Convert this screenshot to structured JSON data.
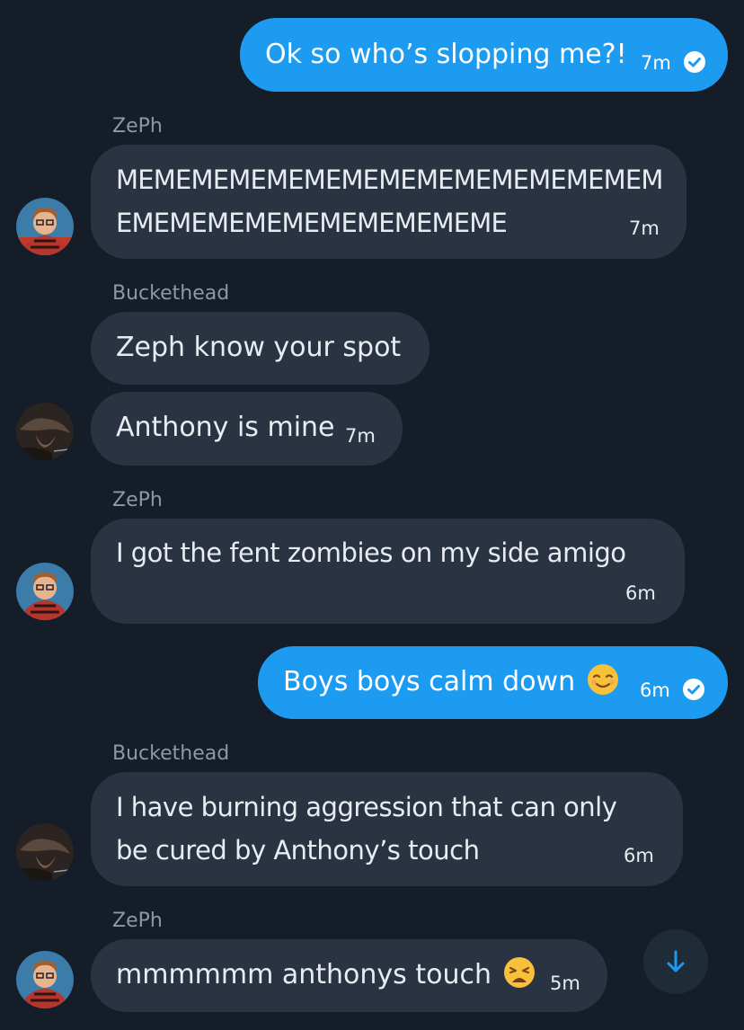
{
  "messages": [
    {
      "text": "Ok so who’s slopping me?!",
      "time": "7m"
    },
    {
      "sender": "ZePh",
      "line1": "MEMEMEMEMEMEMEMEMEMEMEMEMEMEM",
      "line2": "EMEMEMEMEMEMEMEMEMEME",
      "time": "7m"
    },
    {
      "sender": "Buckethead",
      "text": "Zeph know your spot"
    },
    {
      "text": "Anthony is mine",
      "time": "7m"
    },
    {
      "sender": "ZePh",
      "text": "I got the fent zombies on my side amigo",
      "time": "6m"
    },
    {
      "text": "Boys boys calm down",
      "emoji": "relieved-smile-emoji",
      "time": "6m"
    },
    {
      "sender": "Buckethead",
      "line1": "I have burning aggression that can only",
      "line2": "be cured by Anthony’s touch",
      "time": "6m"
    },
    {
      "sender": "ZePh",
      "text": "mmmmmm anthonys touch",
      "emoji": "weary-face-emoji",
      "time": "5m"
    }
  ],
  "colors": {
    "background": "#151d28",
    "incoming_bubble": "#293341",
    "outgoing_bubble": "#1d9bf0",
    "sender_name": "#8b98a5",
    "scroll_arrow": "#1d9bf0"
  },
  "icons": [
    "read-check-icon",
    "scroll-down-arrow-icon"
  ]
}
